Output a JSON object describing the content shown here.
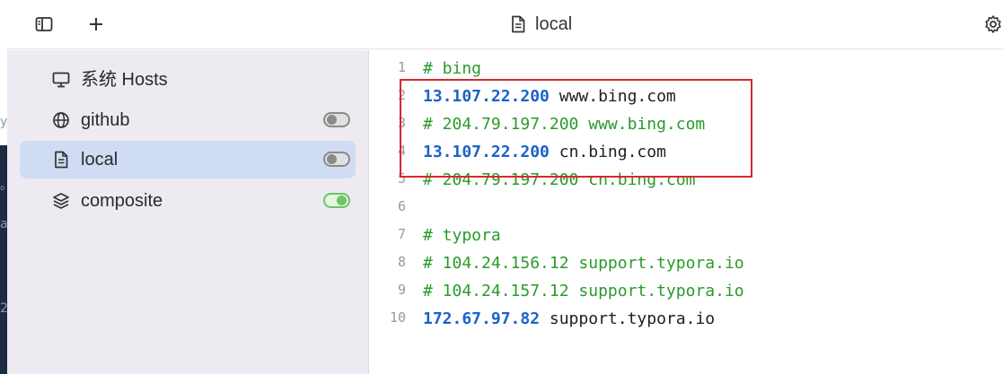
{
  "window": {
    "title": "local"
  },
  "peek": {
    "glyphs": [
      "y",
      "。",
      "a",
      "2"
    ]
  },
  "sidebar": {
    "items": [
      {
        "label": "系统 Hosts",
        "icon": "monitor-icon",
        "toggle": null
      },
      {
        "label": "github",
        "icon": "globe-icon",
        "toggle": "off"
      },
      {
        "label": "local",
        "icon": "file-icon",
        "toggle": "off",
        "active": true
      },
      {
        "label": "composite",
        "icon": "layers-icon",
        "toggle": "on"
      }
    ]
  },
  "editor": {
    "lines": [
      {
        "num": "1",
        "comment": "# bing",
        "ip": "",
        "host": ""
      },
      {
        "num": "2",
        "comment": "",
        "ip": "13.107.22.200",
        "host": " www.bing.com"
      },
      {
        "num": "3",
        "comment": "# 204.79.197.200 www.bing.com",
        "ip": "",
        "host": ""
      },
      {
        "num": "4",
        "comment": "",
        "ip": "13.107.22.200",
        "host": " cn.bing.com"
      },
      {
        "num": "5",
        "comment": "# 204.79.197.200 cn.bing.com",
        "ip": "",
        "host": ""
      },
      {
        "num": "6",
        "comment": "",
        "ip": "",
        "host": ""
      },
      {
        "num": "7",
        "comment": "# typora",
        "ip": "",
        "host": ""
      },
      {
        "num": "8",
        "comment": "# 104.24.156.12 support.typora.io",
        "ip": "",
        "host": ""
      },
      {
        "num": "9",
        "comment": "# 104.24.157.12 support.typora.io",
        "ip": "",
        "host": ""
      },
      {
        "num": "10",
        "comment": "",
        "ip": "172.67.97.82",
        "host": " support.typora.io"
      }
    ]
  },
  "colors": {
    "accent": "#1a63c8",
    "comment": "#2a9a2a",
    "active_bg": "#cfdcf3",
    "toggle_on": "#6cc36a",
    "annotation": "#d9272e"
  }
}
